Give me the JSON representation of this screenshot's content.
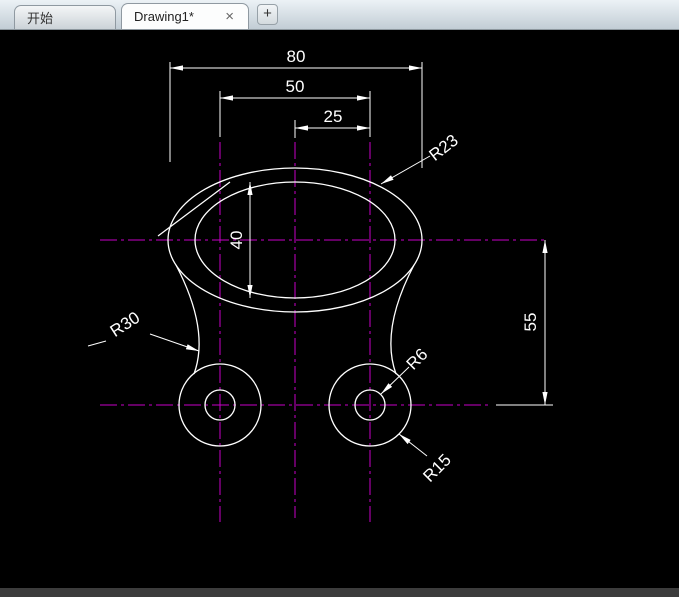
{
  "tabs": {
    "start": {
      "label": "开始"
    },
    "drawing": {
      "label": "Drawing1*",
      "close_icon": "×"
    },
    "new_tab_icon": "+"
  },
  "drawing": {
    "dims": {
      "width_overall": "80",
      "width_holes": "50",
      "width_half": "25",
      "ellipse_height": "40",
      "height_centers": "55",
      "radius_ellipse": "R23",
      "radius_side": "R30",
      "radius_hole_inner": "R6",
      "radius_hole_outer": "R15"
    },
    "colors": {
      "canvas_bg": "#000000",
      "geometry": "#ffffff",
      "centerline": "#c800c8",
      "dimension": "#ffffff"
    }
  }
}
